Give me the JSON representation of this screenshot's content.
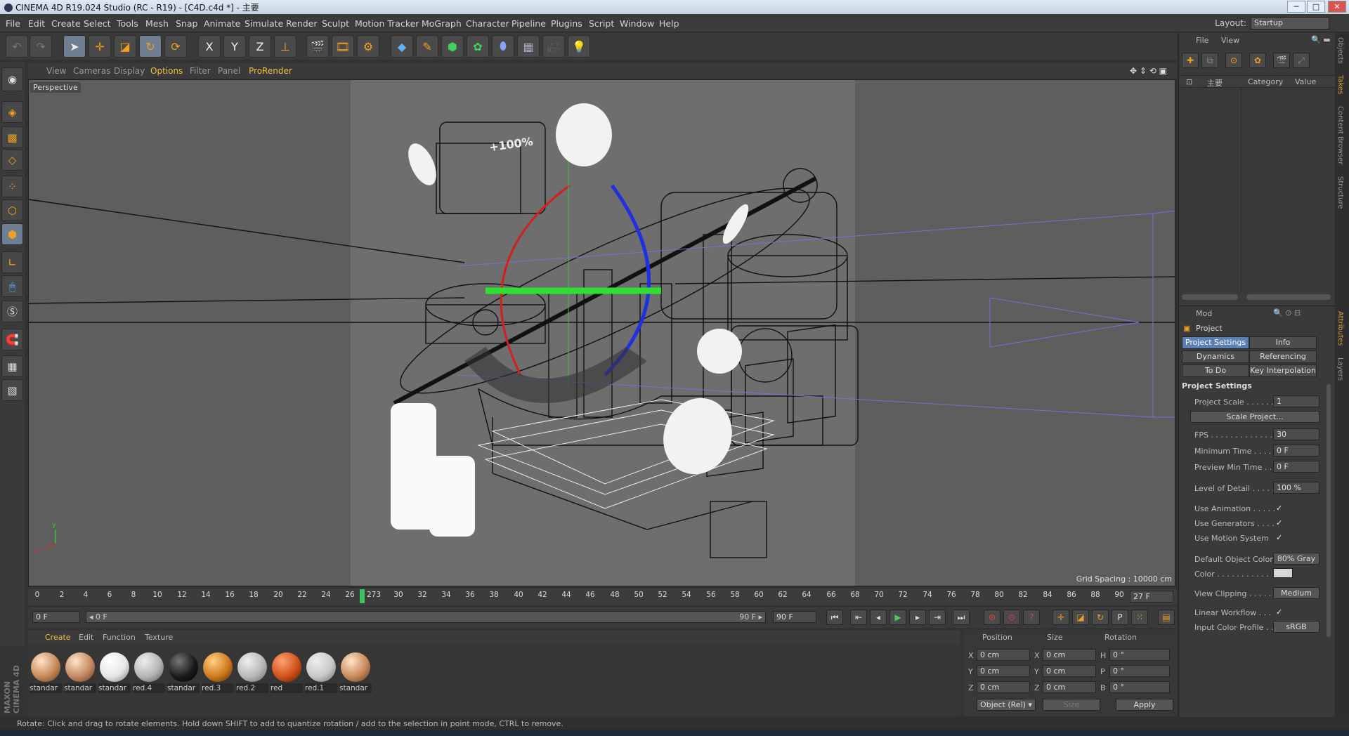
{
  "window": {
    "title": "CINEMA 4D R19.024 Studio (RC - R19) - [C4D.c4d *] - 主要",
    "minimize": "─",
    "maximize": "□",
    "close": "✕"
  },
  "menu": [
    "File",
    "Edit",
    "Create",
    "Select",
    "Tools",
    "Mesh",
    "Snap",
    "Animate",
    "Simulate",
    "Render",
    "Sculpt",
    "Motion Tracker",
    "MoGraph",
    "Character",
    "Pipeline",
    "Plugins",
    "Script",
    "Window",
    "Help"
  ],
  "layout": {
    "label": "Layout:",
    "value": "Startup"
  },
  "toolbar": {
    "axes": [
      "X",
      "Y",
      "Z"
    ]
  },
  "viewport": {
    "menu": [
      "View",
      "Cameras",
      "Display",
      "Options",
      "Filter",
      "Panel",
      "ProRender"
    ],
    "label": "Perspective",
    "grid_spacing": "Grid Spacing : 10000 cm",
    "overlay_text": "+100%",
    "axis_y": "y",
    "axis_x": "x"
  },
  "timeline": {
    "ticks": [
      "0",
      "2",
      "4",
      "6",
      "8",
      "10",
      "12",
      "14",
      "16",
      "18",
      "20",
      "22",
      "24",
      "26",
      "273",
      "30",
      "32",
      "34",
      "36",
      "38",
      "40",
      "42",
      "44",
      "46",
      "48",
      "50",
      "52",
      "54",
      "56",
      "58",
      "60",
      "62",
      "64",
      "66",
      "68",
      "70",
      "72",
      "74",
      "76",
      "78",
      "80",
      "82",
      "84",
      "86",
      "88",
      "90"
    ],
    "current": "27 F"
  },
  "timectrl": {
    "start": "0 F",
    "range_start": "◂ 0 F",
    "range_end": "90 F ▸",
    "end": "90 F"
  },
  "materials": {
    "menu": [
      "Create",
      "Edit",
      "Function",
      "Texture"
    ],
    "items": [
      {
        "name": "standar",
        "color": "#c98a5a"
      },
      {
        "name": "standar",
        "color": "#c48a62"
      },
      {
        "name": "standar",
        "color": "#e6e6e6"
      },
      {
        "name": "red.4",
        "color": "#b5b5b5"
      },
      {
        "name": "standar",
        "color": "#1e1a1a"
      },
      {
        "name": "red.3",
        "color": "#d07a20"
      },
      {
        "name": "red.2",
        "color": "#b8b8b8"
      },
      {
        "name": "red",
        "color": "#d0521a"
      },
      {
        "name": "red.1",
        "color": "#c8c8c8"
      },
      {
        "name": "standar",
        "color": "#c98a5a"
      }
    ],
    "brand": "MAXON CINEMA 4D"
  },
  "coords": {
    "headers": [
      "Position",
      "Size",
      "Rotation"
    ],
    "rows": [
      {
        "a": "X",
        "pos": "0 cm",
        "b": "X",
        "size": "0 cm",
        "c": "H",
        "rot": "0 °"
      },
      {
        "a": "Y",
        "pos": "0 cm",
        "b": "Y",
        "size": "0 cm",
        "c": "P",
        "rot": "0 °"
      },
      {
        "a": "Z",
        "pos": "0 cm",
        "b": "Z",
        "size": "0 cm",
        "c": "B",
        "rot": "0 °"
      }
    ],
    "mode": "Object (Rel) ▾",
    "size_mode": "Size",
    "apply": "Apply"
  },
  "objects": {
    "menu": [
      "File",
      "View"
    ],
    "cols": [
      "主要",
      "Category",
      "Value"
    ]
  },
  "attributes": {
    "mode": "Mod",
    "title": "Project",
    "tabs": [
      "Project Settings",
      "Info",
      "Dynamics",
      "Referencing",
      "To Do",
      "Key Interpolation"
    ],
    "section": "Project Settings",
    "rows": [
      {
        "label": "Project Scale . . . . . .",
        "value": "1"
      },
      {
        "label": "FPS . . . . . . . . . . . . . .",
        "value": "30"
      },
      {
        "label": "Minimum Time . . . .",
        "value": "0 F"
      },
      {
        "label": "Preview Min Time . .",
        "value": "0 F"
      },
      {
        "label": "Level of Detail . . . . .",
        "value": "100 %"
      },
      {
        "label": "Use Animation . . . . .",
        "value": "✓"
      },
      {
        "label": "Use Generators . . . .",
        "value": "✓"
      },
      {
        "label": "Use Motion System",
        "value": "✓"
      },
      {
        "label": "Default Object Color",
        "value": "80% Gray"
      },
      {
        "label": "Color . . . . . . . . . . .",
        "value": ""
      },
      {
        "label": "View Clipping . . . . .",
        "value": "Medium"
      },
      {
        "label": "Linear Workflow . . .",
        "value": "✓"
      },
      {
        "label": "Input Color Profile . .",
        "value": "sRGB"
      }
    ],
    "scale_button": "Scale Project..."
  },
  "sidetabs": [
    "Objects",
    "Takes",
    "Content Browser",
    "Structure",
    "Attributes",
    "Layers"
  ],
  "status": "Rotate: Click and drag to rotate elements. Hold down SHIFT to add to quantize rotation / add to the selection in point mode, CTRL to remove."
}
